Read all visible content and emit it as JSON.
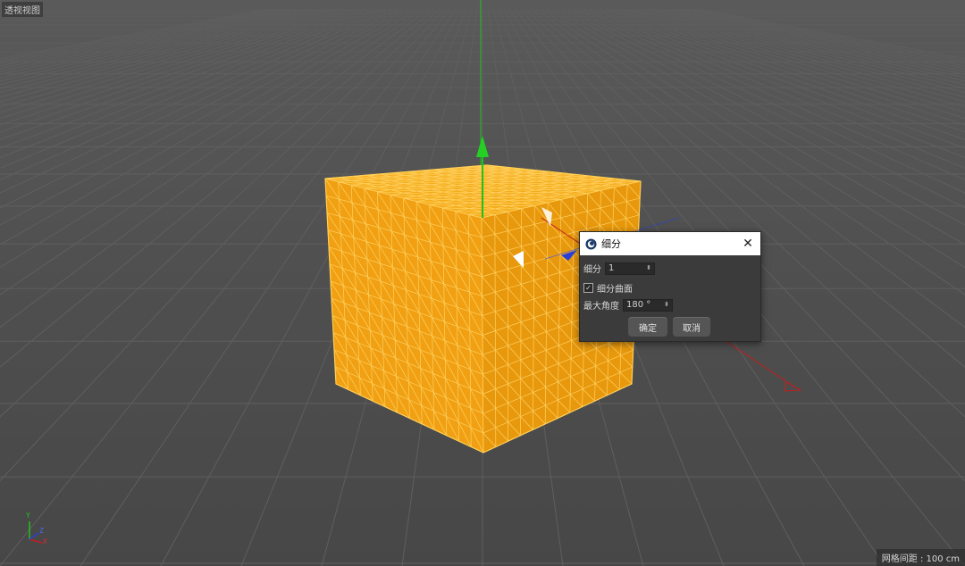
{
  "viewport": {
    "label": "透视视图",
    "grid_spacing": "网格间距 : 100 cm",
    "axis_labels": {
      "y": "Y",
      "z": "Z",
      "x": "X"
    }
  },
  "colors": {
    "viewport_bg": "#4d4d4d",
    "grid_line": "#5e5e5e",
    "cube_face": "#f0a012",
    "cube_wire": "#ffcc55",
    "axis_y": "#21c021",
    "axis_x": "#c02020",
    "axis_z": "#2a3fd8"
  },
  "dialog": {
    "title": "细分",
    "close_icon": "close-icon",
    "subdivision_label": "细分",
    "subdivision_value": "1",
    "subdivide_surface_label": "细分曲面",
    "subdivide_surface_checked": true,
    "max_angle_label": "最大角度",
    "max_angle_value": "180 °",
    "ok_label": "确定",
    "cancel_label": "取消"
  }
}
